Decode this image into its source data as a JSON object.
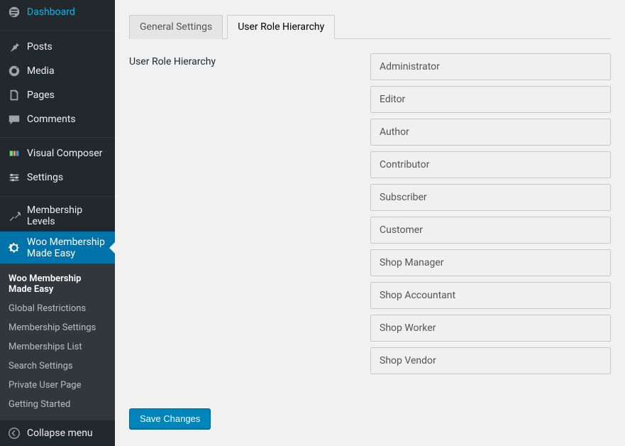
{
  "sidebar": {
    "items": [
      {
        "label": "Dashboard"
      },
      {
        "label": "Posts"
      },
      {
        "label": "Media"
      },
      {
        "label": "Pages"
      },
      {
        "label": "Comments"
      },
      {
        "label": "Visual Composer"
      },
      {
        "label": "Settings"
      },
      {
        "label": "Membership Levels"
      },
      {
        "label": "Woo Membership Made Easy"
      }
    ],
    "submenu": [
      {
        "label": "Woo Membership Made Easy"
      },
      {
        "label": "Global Restrictions"
      },
      {
        "label": "Membership Settings"
      },
      {
        "label": "Memberships List"
      },
      {
        "label": "Search Settings"
      },
      {
        "label": "Private User Page"
      },
      {
        "label": "Getting Started"
      }
    ],
    "collapse_label": "Collapse menu"
  },
  "tabs": [
    {
      "label": "General Settings"
    },
    {
      "label": "User Role Hierarchy"
    }
  ],
  "section_label": "User Role Hierarchy",
  "roles": [
    "Administrator",
    "Editor",
    "Author",
    "Contributor",
    "Subscriber",
    "Customer",
    "Shop Manager",
    "Shop Accountant",
    "Shop Worker",
    "Shop Vendor"
  ],
  "save_button_label": "Save Changes"
}
